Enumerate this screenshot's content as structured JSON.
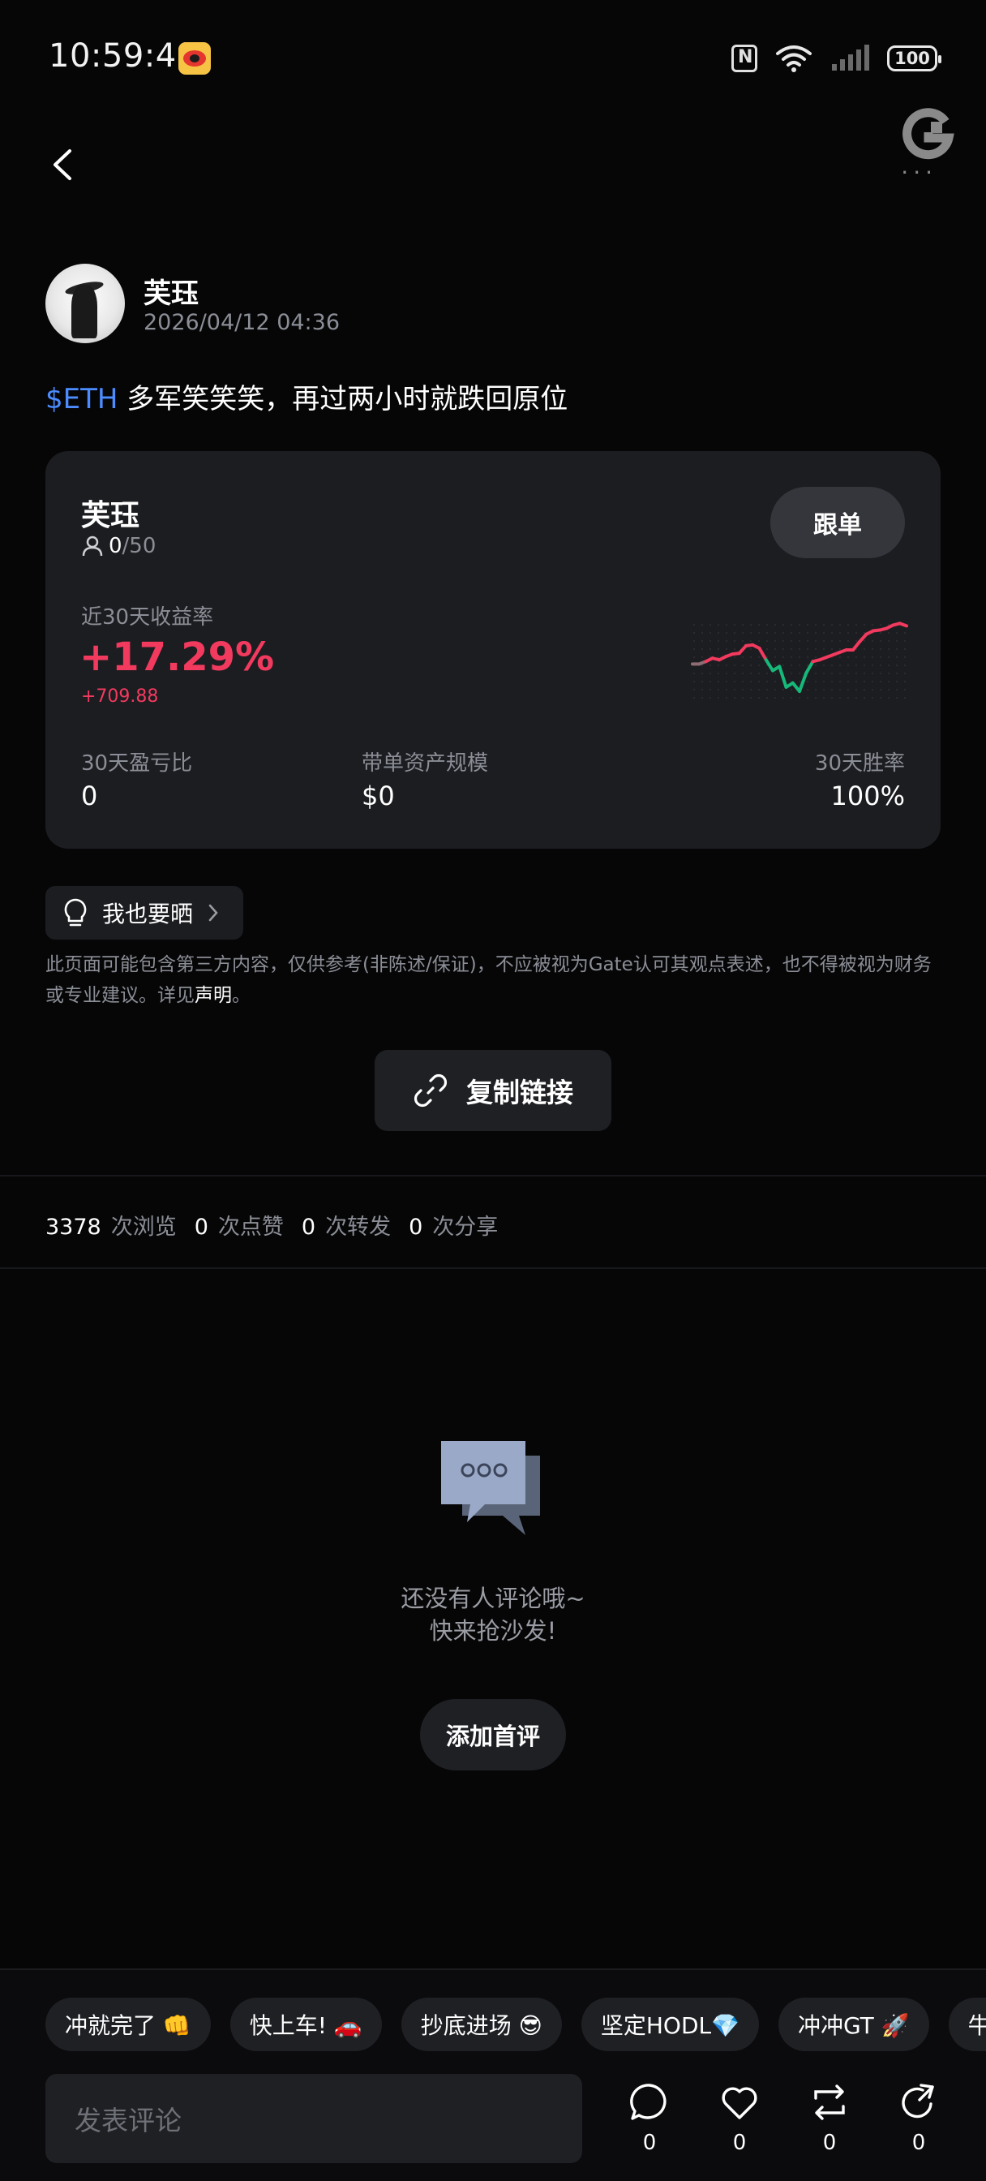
{
  "status_bar": {
    "time": "10:59:49",
    "battery": "100"
  },
  "post": {
    "author": "芙珏",
    "timestamp": "2026/04/12 04:36",
    "tag": "$ETH",
    "text": " 多军笑笑笑，再过两小时就跌回原位"
  },
  "trader_card": {
    "name": "芙珏",
    "followers_current": "0",
    "followers_max": "/50",
    "follow_label": "跟单",
    "roi_label": "近30天收益率",
    "roi_value": "+17.29%",
    "pnl_value": "+709.88",
    "stats": [
      {
        "label": "30天盈亏比",
        "value": "0"
      },
      {
        "label": "带单资产规模",
        "value": "$0"
      },
      {
        "label": "30天胜率",
        "value": "100%"
      }
    ],
    "sparkline": [
      0.33,
      0.33,
      0.36,
      0.4,
      0.38,
      0.42,
      0.45,
      0.46,
      0.55,
      0.56,
      0.52,
      0.38,
      0.25,
      0.3,
      0.05,
      0.1,
      0.0,
      0.22,
      0.36,
      0.38,
      0.41,
      0.44,
      0.47,
      0.5,
      0.5,
      0.6,
      0.69,
      0.73,
      0.74,
      0.76,
      0.8,
      0.82,
      0.79
    ],
    "colors": {
      "up": "#f23a5e",
      "down": "#16b979",
      "neutral": "#8d6d73"
    }
  },
  "share_chip": {
    "label": "我也要晒"
  },
  "disclaimer": {
    "text": "此页面可能包含第三方内容，仅供参考(非陈述/保证)，不应被视为Gate认可其观点表述，也不得被视为财务或专业建议。详见",
    "link": "声明",
    "end": "。"
  },
  "copy_link": {
    "label": "复制链接"
  },
  "engagement": {
    "views": "3378",
    "views_label": "次浏览",
    "likes": "0",
    "likes_label": "次点赞",
    "reposts": "0",
    "reposts_label": "次转发",
    "shares": "0",
    "shares_label": "次分享"
  },
  "comments_empty": {
    "line1": "还没有人评论哦~",
    "line2": "快来抢沙发!",
    "button": "添加首评"
  },
  "quick_replies": [
    "冲就完了 👊",
    "快上车! 🚗",
    "抄底进场 😎",
    "坚定HODL💎",
    "冲冲GT 🚀",
    "牛回"
  ],
  "comment_bar": {
    "placeholder": "发表评论",
    "comment_count": "0",
    "like_count": "0",
    "repost_count": "0",
    "share_count": "0"
  }
}
